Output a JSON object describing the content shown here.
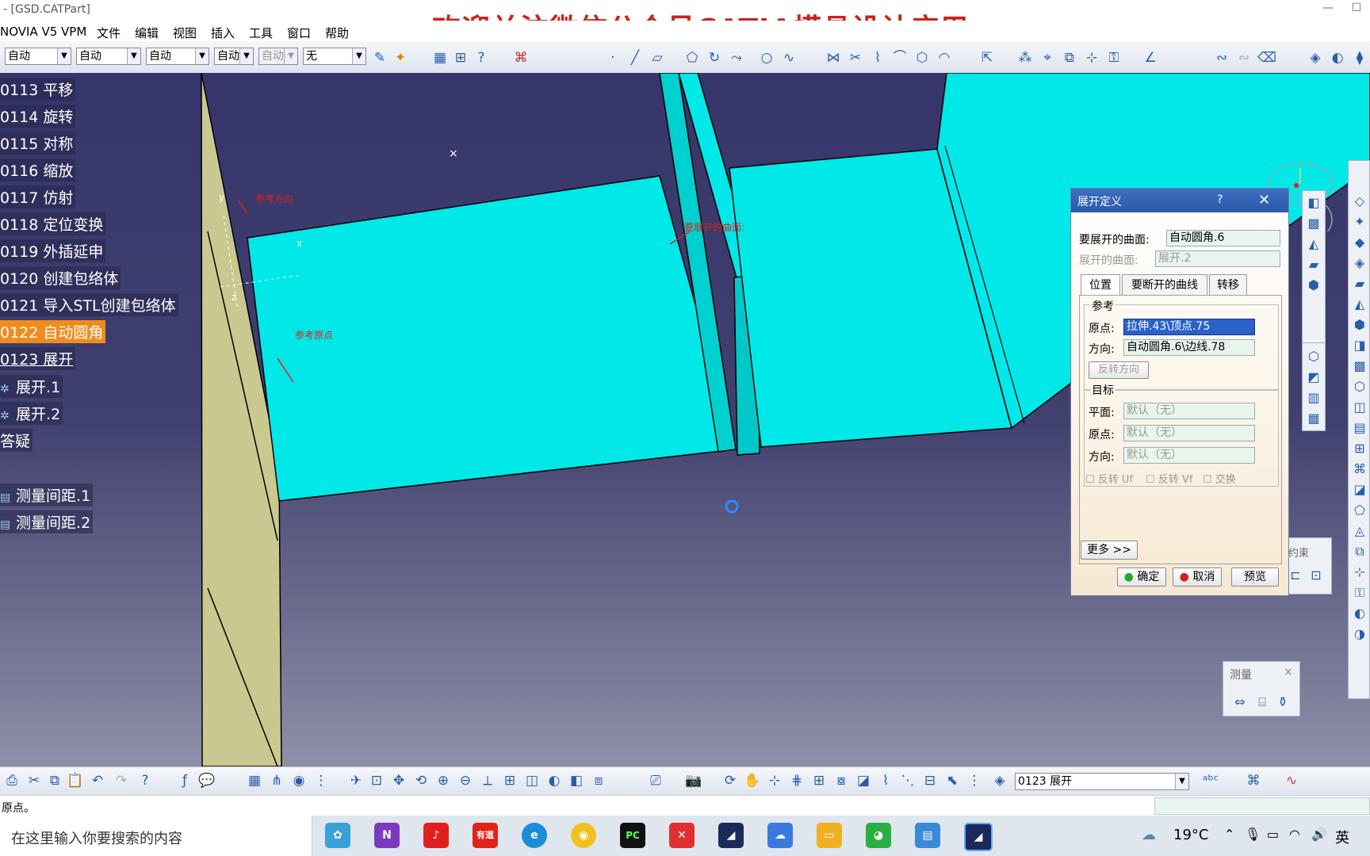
{
  "window": {
    "title": "- [GSD.CATPart]",
    "banner": "欢迎关注微信公众号CATIA模具设计应用"
  },
  "menu": {
    "app": "NOVIA V5 VPM",
    "items": [
      "文件",
      "编辑",
      "视图",
      "插入",
      "工具",
      "窗口",
      "帮助"
    ]
  },
  "toolbar": {
    "combos": [
      "自动",
      "自动",
      "自动",
      "自动",
      "自动",
      "无"
    ]
  },
  "tree": {
    "items": [
      {
        "label": "0113 平移"
      },
      {
        "label": "0114 旋转"
      },
      {
        "label": "0115 对称"
      },
      {
        "label": "0116 缩放"
      },
      {
        "label": "0117 仿射"
      },
      {
        "label": "0118 定位变换"
      },
      {
        "label": "0119 外插延申"
      },
      {
        "label": "0120 创建包络体"
      },
      {
        "label": "0121 导入STL创建包络体"
      },
      {
        "label": "0122 自动圆角"
      },
      {
        "label": "0123 展开"
      },
      {
        "label": "展开.1"
      },
      {
        "label": "展开.2"
      },
      {
        "label": "答疑"
      },
      {
        "label": "测量间距.1"
      },
      {
        "label": "测量间距.2"
      }
    ]
  },
  "annotations": {
    "ref_direction": "参考方向",
    "ref_origin": "参考原点",
    "surface_to_unfold": "要展开的曲面:",
    "axis_y": "y",
    "axis_x": "x",
    "axis_z": "z"
  },
  "dialog": {
    "title": "展开定义",
    "help": "?",
    "surface_label": "要展开的曲面:",
    "surface_value": "自动圆角.6",
    "unfolded_label": "展开的曲面:",
    "unfolded_value": "展开.2",
    "tabs": [
      "位置",
      "要断开的曲线",
      "转移"
    ],
    "reference_group": "参考",
    "origin_label": "原点:",
    "origin_value": "拉伸.43\\顶点.75",
    "direction_label": "方向:",
    "direction_value": "自动圆角.6\\边线.78",
    "reverse_button": "反转方向",
    "target_group": "目标",
    "plane_label": "平面:",
    "plane_value": "默认（无）",
    "t_origin_label": "原点:",
    "t_origin_value": "默认（无）",
    "t_direction_label": "方向:",
    "t_direction_value": "默认（无）",
    "check_u": "反转 Uf",
    "check_v": "反转 Vf",
    "check_swap": "交换",
    "more_button": "更多 >>",
    "ok_button": "确定",
    "cancel_button": "取消",
    "preview_button": "预览"
  },
  "palettes": {
    "constraint_label": "约束",
    "measure_title": "测量"
  },
  "bottombar": {
    "combo_value": "0123 展开"
  },
  "status": {
    "text": "原点。"
  },
  "taskbar": {
    "search_placeholder": "在这里输入你要搜索的内容",
    "weather": "19°C",
    "ime": "英",
    "apps": [
      "onenote",
      "netease-music",
      "youdao",
      "edge",
      "chrome",
      "pycharm",
      "xmind",
      "catia",
      "baidu-netdisk",
      "explorer",
      "wechat",
      "control-panel",
      "catia-active"
    ]
  },
  "colors": {
    "surface": "#00e5e5",
    "wall": "#c8c890",
    "viewport_top": "#35356b",
    "selected": "#f08c1e",
    "dialog_title": "#2b5aab"
  }
}
